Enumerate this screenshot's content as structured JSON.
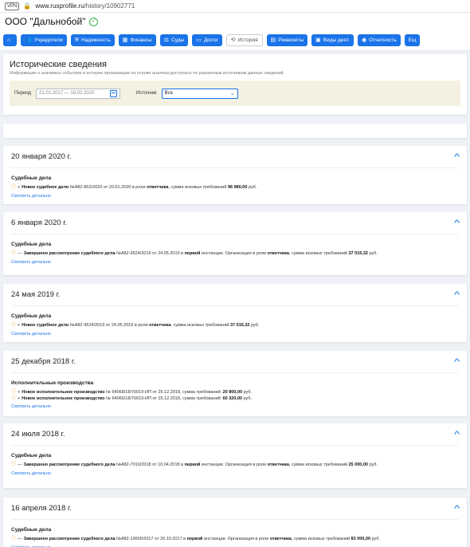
{
  "browser": {
    "vpn_label": "VPN",
    "url_domain": "www.rusprofile.ru",
    "url_path": "/history/10902771"
  },
  "company": {
    "name": "ООО \"Дальнобой\""
  },
  "tabs": [
    {
      "label": "",
      "icon": "home-icon",
      "symbol": "⌂"
    },
    {
      "label": "Учредители",
      "icon": "users-icon",
      "symbol": "👥"
    },
    {
      "label": "Надежность",
      "icon": "shield-icon",
      "symbol": "⛨"
    },
    {
      "label": "Финансы",
      "icon": "chart-icon",
      "symbol": "▦"
    },
    {
      "label": "Суды",
      "icon": "gavel-icon",
      "symbol": "⚖"
    },
    {
      "label": "Долги",
      "icon": "debt-icon",
      "symbol": "▭"
    },
    {
      "label": "История",
      "icon": "history-icon",
      "symbol": "⟲"
    },
    {
      "label": "Реквизиты",
      "icon": "document-icon",
      "symbol": "▤"
    },
    {
      "label": "Виды деят.",
      "icon": "activity-icon",
      "symbol": "▣"
    },
    {
      "label": "Отчетность",
      "icon": "report-icon",
      "symbol": "◉"
    },
    {
      "label": "Ещ",
      "icon": "",
      "symbol": ""
    }
  ],
  "history": {
    "title": "Исторические сведения",
    "subtitle": "Информация о значимых событиях в истории организации на основе анализа доступных по различным источникам данных сведений.",
    "period_label": "Период",
    "period_value": "21.02.2017 — 18.02.2020",
    "source_label": "Источник",
    "source_value": "Все"
  },
  "link_label": "Смотреть детально",
  "events": [
    {
      "date": "20 января 2020 г.",
      "category": "Судебные дела",
      "items": [
        {
          "mark": "+",
          "html": "<b>Новое судебное дело</b> №А82-852/2020 от 20.01.2020 в роли <b>ответчика</b>, сумма исковых требований <b>96 980,00</b> руб."
        }
      ]
    },
    {
      "date": "6 января 2020 г.",
      "category": "Судебные дела",
      "items": [
        {
          "mark": "—",
          "html": "<b>Завершено рассмотрение судебного дела</b> №А82-9524/2019 от 24.05.2019 в <b>первой</b> инстанции. Организация в роли <b>ответчика</b>, сумма исковых требований <b>37 015,32</b> руб."
        }
      ]
    },
    {
      "date": "24 мая 2019 г.",
      "category": "Судебные дела",
      "items": [
        {
          "mark": "+",
          "html": "<b>Новое судебное дело</b> №А82-9524/2019 от 24.05.2019 в роли <b>ответчика</b>, сумма исковых требований <b>37 015,32</b> руб."
        }
      ]
    },
    {
      "date": "25 декабря 2018 г.",
      "category": "Исполнительные производства",
      "items": [
        {
          "mark": "+",
          "html": "<b>Новое исполнительное производство</b> № 64068/18/76019-ИП от 25.12.2018, сумма требований: <b>20 800,00</b> руб."
        },
        {
          "mark": "+",
          "html": "<b>Новое исполнительное производство</b> № 64066/18/76019-ИП от 25.12.2018, сумма требований: <b>60 320,00</b> руб."
        }
      ]
    },
    {
      "date": "24 июля 2018 г.",
      "category": "Судебные дела",
      "items": [
        {
          "mark": "—",
          "html": "<b>Завершено рассмотрение судебного дела</b> №А82-7010/2018 от 10.04.2018 в <b>первой</b> инстанции. Организация в роли <b>ответчика</b>, сумма исковых требований <b>25 000,00</b> руб."
        }
      ]
    },
    {
      "date": "16 апреля 2018 г.",
      "category": "Судебные дела",
      "items": [
        {
          "mark": "—",
          "html": "<b>Завершено рассмотрение судебного дела</b> №А82-19900/2017 от 26.10.2017 в <b>первой</b> инстанции. Организация в роли <b>ответчика</b>, сумма исковых требований <b>83 000,00</b> руб."
        }
      ]
    }
  ]
}
